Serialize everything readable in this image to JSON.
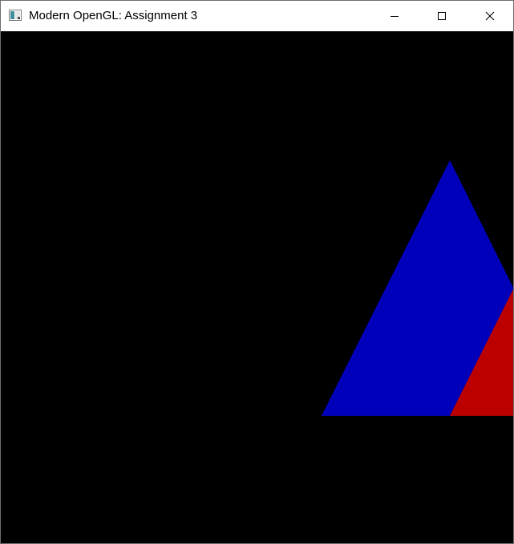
{
  "window": {
    "title": "Modern OpenGL: Assignment 3",
    "app_icon": "application-window-icon",
    "controls": {
      "minimize": "minimize-icon",
      "maximize": "maximize-icon",
      "close": "close-icon"
    }
  },
  "viewport": {
    "background_color": "#000000",
    "shapes": [
      {
        "name": "blue-triangle",
        "color": "#0000bb"
      },
      {
        "name": "red-triangle",
        "color": "#bb0000"
      }
    ]
  }
}
